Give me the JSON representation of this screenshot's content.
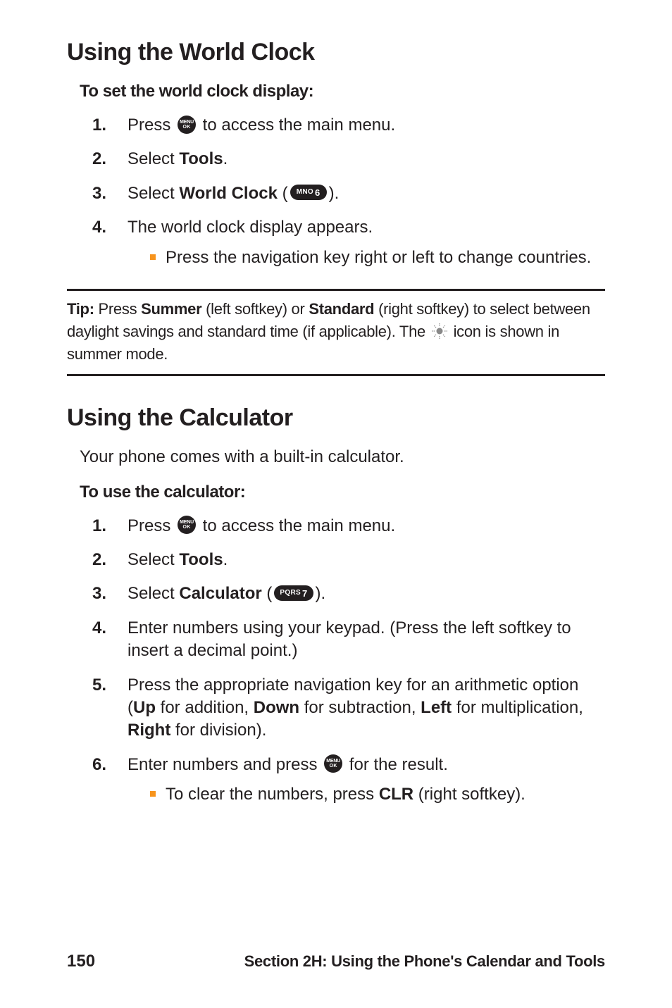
{
  "worldclock": {
    "title": "Using the World Clock",
    "subhead": "To set the world clock display:",
    "step1_a": "Press ",
    "step1_b": " to access the main menu.",
    "step2_a": "Select ",
    "step2_b": "Tools",
    "step2_c": ".",
    "step3_a": "Select ",
    "step3_b": "World Clock",
    "step3_c": " (",
    "step3_d": ").",
    "step4": "The world clock display appears.",
    "step4_sub": "Press the navigation key right or left to change countries."
  },
  "tip": {
    "label": "Tip: ",
    "a": "Press ",
    "summer": "Summer",
    "b": " (left softkey) or ",
    "standard": "Standard",
    "c": " (right softkey) to select between daylight savings and standard time (if applicable). The ",
    "d": " icon is shown in summer mode."
  },
  "calculator": {
    "title": "Using the Calculator",
    "intro": "Your phone comes with a built-in calculator.",
    "subhead": "To use the calculator:",
    "step1_a": "Press ",
    "step1_b": " to access the main menu.",
    "step2_a": "Select ",
    "step2_b": "Tools",
    "step2_c": ".",
    "step3_a": "Select ",
    "step3_b": "Calculator",
    "step3_c": " (",
    "step3_d": ").",
    "step4": "Enter numbers using your keypad. (Press the left softkey to insert a decimal point.)",
    "step5_a": "Press the appropriate navigation key for an arithmetic option (",
    "step5_up": "Up",
    "step5_b": " for addition, ",
    "step5_down": "Down",
    "step5_c": " for subtraction, ",
    "step5_left": "Left",
    "step5_d": " for multiplication, ",
    "step5_right": "Right",
    "step5_e": " for division).",
    "step6_a": "Enter numbers and press ",
    "step6_b": " for the result.",
    "step6_sub_a": "To clear the numbers, press ",
    "step6_sub_clr": "CLR",
    "step6_sub_b": " (right softkey)."
  },
  "keys": {
    "menu_top": "MENU",
    "menu_bot": "OK",
    "mno": "MNO",
    "six": "6",
    "pqrs": "PQRS",
    "seven": "7"
  },
  "footer": {
    "page": "150",
    "section": "Section 2H: Using the Phone's Calendar and Tools"
  }
}
